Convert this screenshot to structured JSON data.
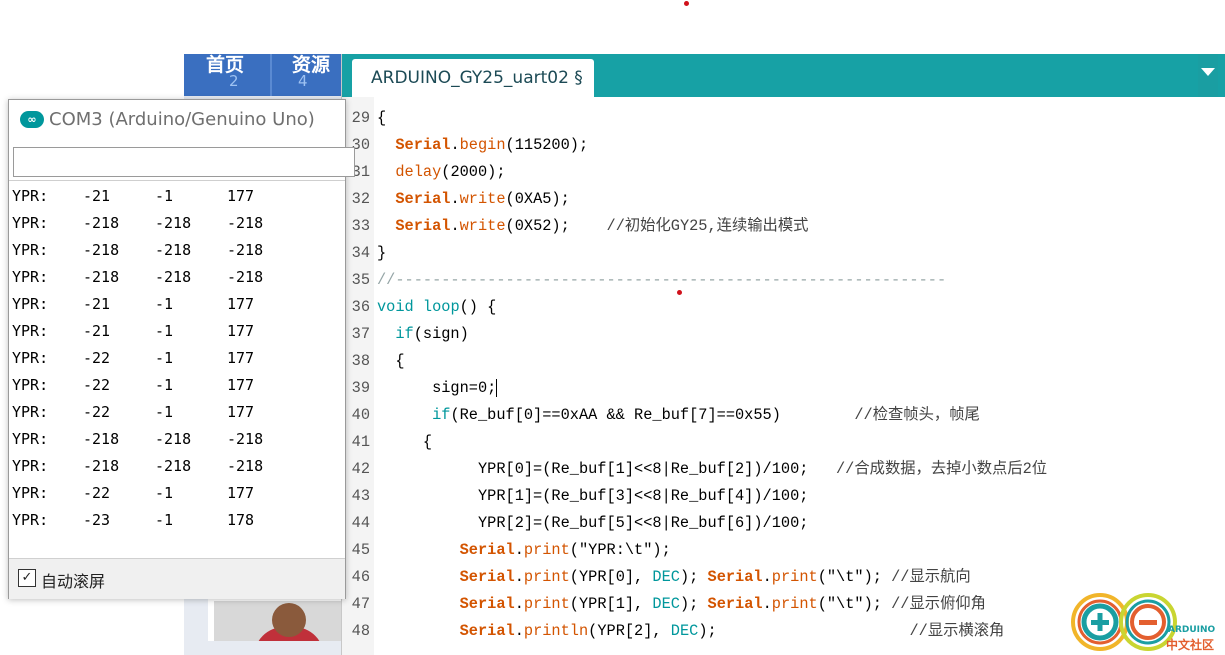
{
  "web": {
    "nav_items": [
      {
        "label": "首页",
        "count": "2"
      },
      {
        "label": "资源",
        "count": "4"
      }
    ]
  },
  "serial": {
    "logo_glyph": "∞",
    "title": "COM3 (Arduino/Genuino Uno)",
    "input_value": "",
    "rows": [
      [
        "YPR:",
        "-21",
        "-1",
        "177"
      ],
      [
        "YPR:",
        "-218",
        "-218",
        "-218"
      ],
      [
        "YPR:",
        "-218",
        "-218",
        "-218"
      ],
      [
        "YPR:",
        "-218",
        "-218",
        "-218"
      ],
      [
        "YPR:",
        "-21",
        "-1",
        "177"
      ],
      [
        "YPR:",
        "-21",
        "-1",
        "177"
      ],
      [
        "YPR:",
        "-22",
        "-1",
        "177"
      ],
      [
        "YPR:",
        "-22",
        "-1",
        "177"
      ],
      [
        "YPR:",
        "-22",
        "-1",
        "177"
      ],
      [
        "YPR:",
        "-218",
        "-218",
        "-218"
      ],
      [
        "YPR:",
        "-218",
        "-218",
        "-218"
      ],
      [
        "YPR:",
        "-22",
        "-1",
        "177"
      ],
      [
        "YPR:",
        "-23",
        "-1",
        "178"
      ]
    ],
    "autoscroll_checked": true,
    "autoscroll_mark": "✓",
    "autoscroll_label": "自动滚屏"
  },
  "ide": {
    "tab_label": "ARDUINO_GY25_uart02 §",
    "code_lines": [
      {
        "n": "29",
        "parts": [
          {
            "t": "{",
            "c": ""
          }
        ]
      },
      {
        "n": "30",
        "parts": [
          {
            "t": "  ",
            "c": ""
          },
          {
            "t": "Serial",
            "c": "kw"
          },
          {
            "t": ".",
            "c": ""
          },
          {
            "t": "begin",
            "c": "fn"
          },
          {
            "t": "(115200);",
            "c": ""
          }
        ]
      },
      {
        "n": "31",
        "parts": [
          {
            "t": "  ",
            "c": ""
          },
          {
            "t": "delay",
            "c": "fn"
          },
          {
            "t": "(2000);",
            "c": ""
          }
        ]
      },
      {
        "n": "32",
        "parts": [
          {
            "t": "  ",
            "c": ""
          },
          {
            "t": "Serial",
            "c": "kw"
          },
          {
            "t": ".",
            "c": ""
          },
          {
            "t": "write",
            "c": "fn"
          },
          {
            "t": "(0XA5);",
            "c": ""
          }
        ]
      },
      {
        "n": "33",
        "parts": [
          {
            "t": "  ",
            "c": ""
          },
          {
            "t": "Serial",
            "c": "kw"
          },
          {
            "t": ".",
            "c": ""
          },
          {
            "t": "write",
            "c": "fn"
          },
          {
            "t": "(0X52);    ",
            "c": ""
          },
          {
            "t": "//初始化GY25,连续输出模式",
            "c": "cmt"
          }
        ]
      },
      {
        "n": "34",
        "parts": [
          {
            "t": "}",
            "c": ""
          }
        ]
      },
      {
        "n": "35",
        "parts": [
          {
            "t": "//------------------------------------------------------------",
            "c": "cm"
          }
        ]
      },
      {
        "n": "36",
        "parts": [
          {
            "t": "void",
            "c": "cy"
          },
          {
            "t": " ",
            "c": ""
          },
          {
            "t": "loop",
            "c": "cy"
          },
          {
            "t": "() {",
            "c": ""
          }
        ]
      },
      {
        "n": "37",
        "parts": [
          {
            "t": "  ",
            "c": ""
          },
          {
            "t": "if",
            "c": "cy"
          },
          {
            "t": "(sign)",
            "c": ""
          }
        ]
      },
      {
        "n": "38",
        "parts": [
          {
            "t": "  {",
            "c": ""
          }
        ]
      },
      {
        "n": "39",
        "parts": [
          {
            "t": "      sign=0;",
            "c": ""
          }
        ],
        "cursor": true
      },
      {
        "n": "40",
        "parts": [
          {
            "t": "      ",
            "c": ""
          },
          {
            "t": "if",
            "c": "cy"
          },
          {
            "t": "(Re_buf[0]==0xAA && Re_buf[7]==0x55)        ",
            "c": ""
          },
          {
            "t": "//检查帧头，帧尾",
            "c": "cmt"
          }
        ]
      },
      {
        "n": "41",
        "parts": [
          {
            "t": "     {",
            "c": ""
          }
        ]
      },
      {
        "n": "42",
        "parts": [
          {
            "t": "           YPR[0]=(Re_buf[1]<<8|Re_buf[2])/100;   ",
            "c": ""
          },
          {
            "t": "//合成数据，去掉小数点后2位",
            "c": "cmt"
          }
        ]
      },
      {
        "n": "43",
        "parts": [
          {
            "t": "           YPR[1]=(Re_buf[3]<<8|Re_buf[4])/100;",
            "c": ""
          }
        ]
      },
      {
        "n": "44",
        "parts": [
          {
            "t": "           YPR[2]=(Re_buf[5]<<8|Re_buf[6])/100;",
            "c": ""
          }
        ]
      },
      {
        "n": "45",
        "parts": [
          {
            "t": "         ",
            "c": ""
          },
          {
            "t": "Serial",
            "c": "kw"
          },
          {
            "t": ".",
            "c": ""
          },
          {
            "t": "print",
            "c": "fn"
          },
          {
            "t": "(\"YPR:\\t\");",
            "c": ""
          }
        ]
      },
      {
        "n": "46",
        "parts": [
          {
            "t": "         ",
            "c": ""
          },
          {
            "t": "Serial",
            "c": "kw"
          },
          {
            "t": ".",
            "c": ""
          },
          {
            "t": "print",
            "c": "fn"
          },
          {
            "t": "(YPR[0], ",
            "c": ""
          },
          {
            "t": "DEC",
            "c": "cy"
          },
          {
            "t": "); ",
            "c": ""
          },
          {
            "t": "Serial",
            "c": "kw"
          },
          {
            "t": ".",
            "c": ""
          },
          {
            "t": "print",
            "c": "fn"
          },
          {
            "t": "(\"\\t\"); ",
            "c": ""
          },
          {
            "t": "//显示航向",
            "c": "cmt"
          }
        ]
      },
      {
        "n": "47",
        "parts": [
          {
            "t": "         ",
            "c": ""
          },
          {
            "t": "Serial",
            "c": "kw"
          },
          {
            "t": ".",
            "c": ""
          },
          {
            "t": "print",
            "c": "fn"
          },
          {
            "t": "(YPR[1], ",
            "c": ""
          },
          {
            "t": "DEC",
            "c": "cy"
          },
          {
            "t": "); ",
            "c": ""
          },
          {
            "t": "Serial",
            "c": "kw"
          },
          {
            "t": ".",
            "c": ""
          },
          {
            "t": "print",
            "c": "fn"
          },
          {
            "t": "(\"\\t\"); ",
            "c": ""
          },
          {
            "t": "//显示俯仰角",
            "c": "cmt"
          }
        ]
      },
      {
        "n": "48",
        "parts": [
          {
            "t": "         ",
            "c": ""
          },
          {
            "t": "Serial",
            "c": "kw"
          },
          {
            "t": ".",
            "c": ""
          },
          {
            "t": "println",
            "c": "fn"
          },
          {
            "t": "(YPR[2], ",
            "c": ""
          },
          {
            "t": "DEC",
            "c": "cy"
          },
          {
            "t": ");                     ",
            "c": ""
          },
          {
            "t": "//显示横滚角",
            "c": "cmt"
          }
        ]
      }
    ]
  },
  "watermark": {
    "line1": "ARDUINO",
    "line2": "中文社区"
  },
  "colors": {
    "ide_teal": "#17a1a5",
    "keyword_orange": "#d35400",
    "type_teal": "#00979c"
  }
}
